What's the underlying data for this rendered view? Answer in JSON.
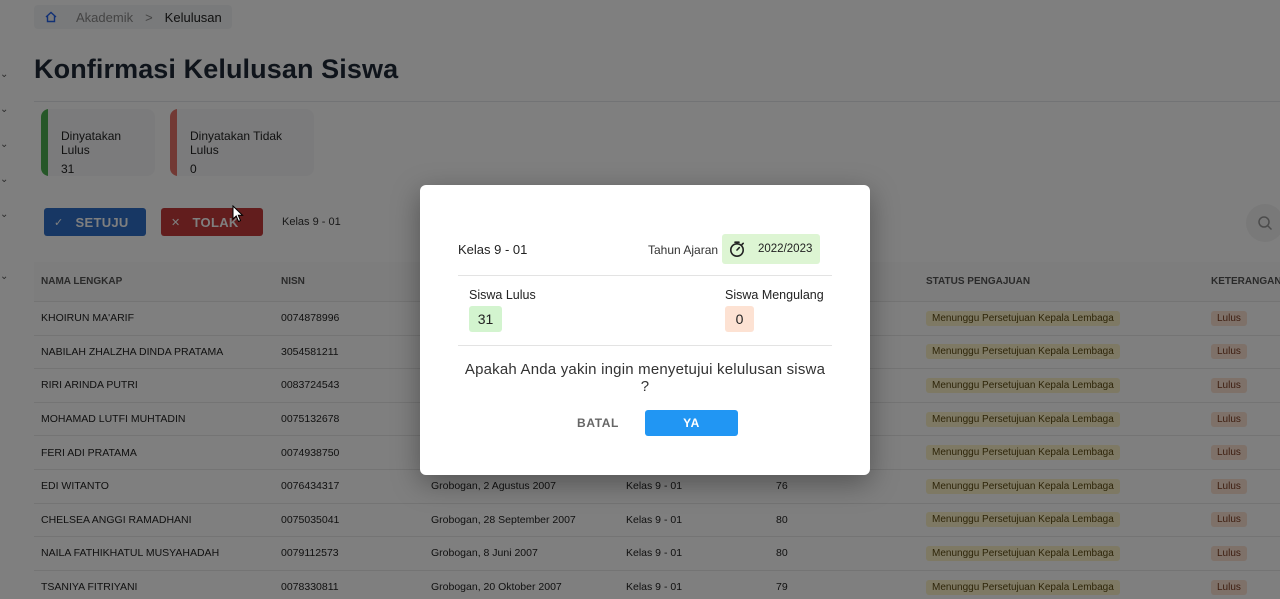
{
  "breadcrumb": {
    "items": [
      "Akademik"
    ],
    "separator": ">",
    "current": "Kelulusan"
  },
  "page": {
    "title": "Konfirmasi Kelulusan Siswa"
  },
  "stats": [
    {
      "label": "Dinyatakan Lulus",
      "value": "31",
      "color": "#4caf50"
    },
    {
      "label": "Dinyatakan Tidak Lulus",
      "value": "0",
      "color": "#e57368"
    }
  ],
  "actions": {
    "setuju": "SETUJU",
    "tolak": "TOLAK",
    "class_filter": "Kelas 9 - 01"
  },
  "table": {
    "headers": [
      "NAMA LENGKAP",
      "NISN",
      "",
      "",
      "",
      "STATUS PENGAJUAN",
      "KETERANGAN"
    ],
    "rows": [
      {
        "name": "KHOIRUN MA'ARIF",
        "nisn": "0074878996",
        "ttl": "",
        "kelas": "",
        "nilai": "",
        "status": "Menunggu Persetujuan Kepala Lembaga",
        "ket": "Lulus"
      },
      {
        "name": "NABILAH ZHALZHA DINDA PRATAMA",
        "nisn": "3054581211",
        "ttl": "",
        "kelas": "",
        "nilai": "",
        "status": "Menunggu Persetujuan Kepala Lembaga",
        "ket": "Lulus"
      },
      {
        "name": "RIRI ARINDA PUTRI",
        "nisn": "0083724543",
        "ttl": "",
        "kelas": "",
        "nilai": "",
        "status": "Menunggu Persetujuan Kepala Lembaga",
        "ket": "Lulus"
      },
      {
        "name": "MOHAMAD LUTFI MUHTADIN",
        "nisn": "0075132678",
        "ttl": "",
        "kelas": "",
        "nilai": "",
        "status": "Menunggu Persetujuan Kepala Lembaga",
        "ket": "Lulus"
      },
      {
        "name": "FERI ADI PRATAMA",
        "nisn": "0074938750",
        "ttl": "",
        "kelas": "",
        "nilai": "",
        "status": "Menunggu Persetujuan Kepala Lembaga",
        "ket": "Lulus"
      },
      {
        "name": "EDI WITANTO",
        "nisn": "0076434317",
        "ttl": "Grobogan, 2 Agustus 2007",
        "kelas": "Kelas 9 - 01",
        "nilai": "76",
        "status": "Menunggu Persetujuan Kepala Lembaga",
        "ket": "Lulus"
      },
      {
        "name": "CHELSEA ANGGI RAMADHANI",
        "nisn": "0075035041",
        "ttl": "Grobogan, 28 September 2007",
        "kelas": "Kelas 9 - 01",
        "nilai": "80",
        "status": "Menunggu Persetujuan Kepala Lembaga",
        "ket": "Lulus"
      },
      {
        "name": "NAILA FATHIKHATUL MUSYAHADAH",
        "nisn": "0079112573",
        "ttl": "Grobogan, 8 Juni 2007",
        "kelas": "Kelas 9 - 01",
        "nilai": "80",
        "status": "Menunggu Persetujuan Kepala Lembaga",
        "ket": "Lulus"
      },
      {
        "name": "TSANIYA FITRIYANI",
        "nisn": "0078330811",
        "ttl": "Grobogan, 20 Oktober 2007",
        "kelas": "Kelas 9 - 01",
        "nilai": "79",
        "status": "Menunggu Persetujuan Kepala Lembaga",
        "ket": "Lulus"
      }
    ]
  },
  "modal": {
    "class_name": "Kelas 9 - 01",
    "year_label": "Tahun Ajaran",
    "year_value": "2022/2023",
    "passed_label": "Siswa Lulus",
    "passed_value": "31",
    "repeat_label": "Siswa Mengulang",
    "repeat_value": "0",
    "question_line1": "Apakah Anda yakin ingin menyetujui kelulusan siswa",
    "question_line2": "?",
    "cancel_label": "BATAL",
    "confirm_label": "YA"
  }
}
